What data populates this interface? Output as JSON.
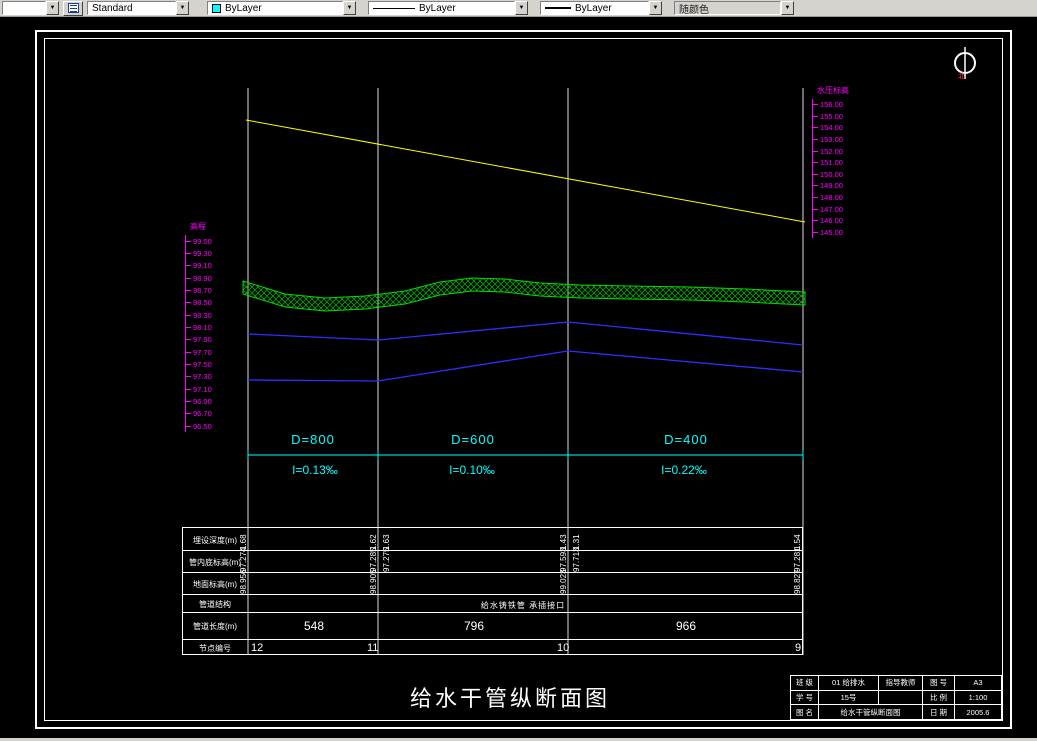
{
  "toolbar": {
    "left_combo": {
      "value": ""
    },
    "text_style": {
      "value": "Standard"
    },
    "color": {
      "value": "ByLayer",
      "swatch": "#00ffff"
    },
    "linetype": {
      "value": "ByLayer"
    },
    "lineweight": {
      "value": "ByLayer"
    },
    "plot_style": {
      "value": "随颜色"
    }
  },
  "north_arrow": {
    "label": "北"
  },
  "profile": {
    "title": "给水干管纵断面图",
    "left_scale": {
      "label": "高程",
      "ticks": [
        "99.50",
        "99.30",
        "99.10",
        "98.90",
        "98.70",
        "98.50",
        "98.30",
        "98.10",
        "97.90",
        "97.70",
        "97.50",
        "97.30",
        "97.10",
        "96.90",
        "96.70",
        "96.50"
      ]
    },
    "right_scale": {
      "label": "水压标高",
      "ticks": [
        "156.00",
        "155.00",
        "154.00",
        "153.00",
        "152.00",
        "151.00",
        "150.00",
        "149.00",
        "148.00",
        "147.00",
        "146.00",
        "145.00"
      ]
    },
    "segments": [
      {
        "diameter": "D=800",
        "slope": "I=0.13‰",
        "length": "548"
      },
      {
        "diameter": "D=600",
        "slope": "I=0.10‰",
        "length": "796"
      },
      {
        "diameter": "D=400",
        "slope": "I=0.22‰",
        "length": "966"
      }
    ],
    "stations": [
      {
        "node": "12",
        "depth": [
          "1.68"
        ],
        "invert": [
          "97.274"
        ],
        "ground": [
          "98.956"
        ]
      },
      {
        "node": "11",
        "depth": [
          "1.62",
          "1.63"
        ],
        "invert": [
          "97.285",
          "97.275"
        ],
        "ground": [
          "98.905"
        ]
      },
      {
        "node": "10",
        "depth": [
          "1.43",
          "1.31"
        ],
        "invert": [
          "97.593",
          "97.713"
        ],
        "ground": [
          "99.023"
        ]
      },
      {
        "node": "9",
        "depth": [
          "1.54"
        ],
        "invert": [
          "97.281"
        ],
        "ground": [
          "98.827"
        ]
      }
    ],
    "table": {
      "row_labels": [
        "埋设深度(m)",
        "管内底标高(m)",
        "地面标高(m)",
        "管道结构",
        "管道长度(m)",
        "节点编号"
      ],
      "structure": "给水铸铁管 承插接口"
    }
  },
  "titleblock": {
    "class_label": "班 级",
    "class_value": "01 给排水",
    "teacher_label": "指导教师",
    "sheet_label": "图 号",
    "sheet_value": "A3",
    "id_label": "学 号",
    "id_value": "15号",
    "scale_label": "比 例",
    "scale_value": "1:100",
    "name_label": "图 名",
    "drawing_name": "给水干管纵断面图",
    "date_label": "日 期",
    "date_value": "2005.6"
  }
}
